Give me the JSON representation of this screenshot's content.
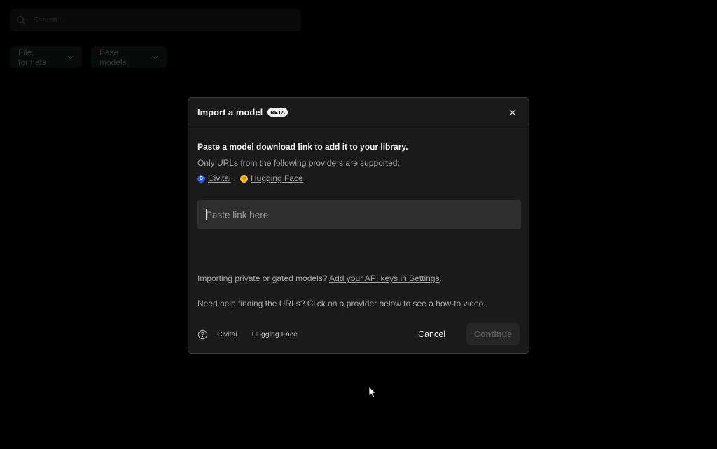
{
  "background": {
    "search": {
      "placeholder": "Search ..."
    },
    "filters": [
      {
        "label": "File formats"
      },
      {
        "label": "Base models"
      }
    ]
  },
  "modal": {
    "title": "Import a model",
    "badge": "BETA",
    "lead": "Paste a model download link to add it to your library.",
    "supported_text": "Only URLs from the following providers are supported:",
    "providers": [
      {
        "name": "Civitai",
        "icon": "civitai-logo-icon",
        "color": "#2b5bd7"
      },
      {
        "name": "Hugging Face",
        "icon": "hugging-face-emoji-icon",
        "color": "#f2b735"
      }
    ],
    "separator": ",",
    "input": {
      "placeholder": "Paste link here",
      "value": ""
    },
    "private_text": "Importing private or gated models?",
    "api_keys_link": "Add your API keys in Settings",
    "private_suffix": ".",
    "help_text": "Need help finding the URLs? Click on a provider below to see a how-to video.",
    "footer": {
      "help_icon": "question-circle-icon",
      "links": [
        "Civitai",
        "Hugging Face"
      ],
      "cancel": "Cancel",
      "continue": "Continue"
    }
  }
}
